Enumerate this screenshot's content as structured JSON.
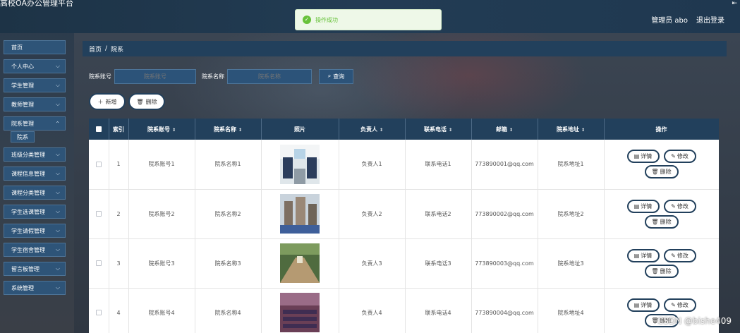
{
  "header": {
    "app_title": "高校OA办公管理平台",
    "user_label": "管理员 abo",
    "logout_label": "退出登录",
    "corner_glyph": "⇤"
  },
  "toast": {
    "message": "操作成功"
  },
  "sidebar": {
    "items": [
      {
        "label": "首页"
      },
      {
        "label": "个人中心"
      },
      {
        "label": "学生管理"
      },
      {
        "label": "教师管理"
      },
      {
        "label": "院系管理",
        "sub": "院系"
      },
      {
        "label": "班级分类管理"
      },
      {
        "label": "课程信息管理"
      },
      {
        "label": "课程分类管理"
      },
      {
        "label": "学生选课管理"
      },
      {
        "label": "学生请假管理"
      },
      {
        "label": "学生宿舍管理"
      },
      {
        "label": "留言板管理"
      },
      {
        "label": "系统管理"
      }
    ]
  },
  "breadcrumb": {
    "home": "首页",
    "separator": "/",
    "current": "院系"
  },
  "search": {
    "dept_no_label": "院系账号",
    "dept_no_placeholder": "院系账号",
    "dept_name_label": "院系名称",
    "dept_name_placeholder": "院系名称",
    "query_label": "查询"
  },
  "actions": {
    "add_label": "新增",
    "delete_label": "删除"
  },
  "table": {
    "columns": [
      "索引",
      "院系账号",
      "院系名称",
      "照片",
      "负责人",
      "联系电话",
      "邮箱",
      "院系地址",
      "操作"
    ],
    "rows": [
      {
        "index": "1",
        "dept_no": "院系账号1",
        "dept_name": "院系名称1",
        "leader": "负责人1",
        "phone": "联系电话1",
        "email": "773890001@qq.com",
        "address": "院系地址1"
      },
      {
        "index": "2",
        "dept_no": "院系账号2",
        "dept_name": "院系名称2",
        "leader": "负责人2",
        "phone": "联系电话2",
        "email": "773890002@qq.com",
        "address": "院系地址2"
      },
      {
        "index": "3",
        "dept_no": "院系账号3",
        "dept_name": "院系名称3",
        "leader": "负责人3",
        "phone": "联系电话3",
        "email": "773890003@qq.com",
        "address": "院系地址3"
      },
      {
        "index": "4",
        "dept_no": "院系账号4",
        "dept_name": "院系名称4",
        "leader": "负责人4",
        "phone": "联系电话4",
        "email": "773890004@qq.com",
        "address": "院系地址4"
      }
    ],
    "op_detail": "详情",
    "op_edit": "修改",
    "op_delete": "删除"
  },
  "watermark": "CSDN @bishe409",
  "colors": {
    "primary": "#22405c",
    "button": "#2c5379",
    "toast_success": "#67c23a"
  }
}
